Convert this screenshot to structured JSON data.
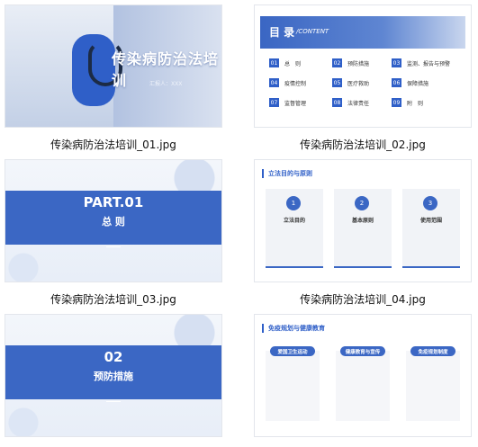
{
  "files": [
    {
      "caption": "传染病防治法培训_01.jpg"
    },
    {
      "caption": "传染病防治法培训_02.jpg"
    },
    {
      "caption": "传染病防治法培训_03.jpg"
    },
    {
      "caption": "传染病防治法培训_04.jpg"
    },
    {
      "caption": "传染病防治法培训_05.jpg"
    },
    {
      "caption": "传染病防治法培训_06.jpg"
    }
  ],
  "slide1": {
    "title": "传染病防治法培训",
    "sub": "汇报人：XXX"
  },
  "slide2": {
    "title": "目 录",
    "title_en": "/CONTENT",
    "items": [
      {
        "num": "01",
        "label": "总　则"
      },
      {
        "num": "02",
        "label": "预防措施"
      },
      {
        "num": "03",
        "label": "监测、报告与预警"
      },
      {
        "num": "04",
        "label": "疫情控制"
      },
      {
        "num": "05",
        "label": "医疗救助"
      },
      {
        "num": "06",
        "label": "保障措施"
      },
      {
        "num": "07",
        "label": "监督管理"
      },
      {
        "num": "08",
        "label": "法律责任"
      },
      {
        "num": "09",
        "label": "附　则"
      }
    ]
  },
  "slide3": {
    "part": "PART.01",
    "name": "总 则"
  },
  "slide4": {
    "heading": "立法目的与原则",
    "cards": [
      {
        "num": "1",
        "title": "立法目的"
      },
      {
        "num": "2",
        "title": "基本原则"
      },
      {
        "num": "3",
        "title": "使用范围"
      }
    ]
  },
  "slide5": {
    "part": "02",
    "name": "预防措施"
  },
  "slide6": {
    "heading": "免疫规划与健康教育",
    "pills": [
      "爱国卫生运动",
      "健康教育与宣传",
      "免疫规划制度"
    ]
  }
}
